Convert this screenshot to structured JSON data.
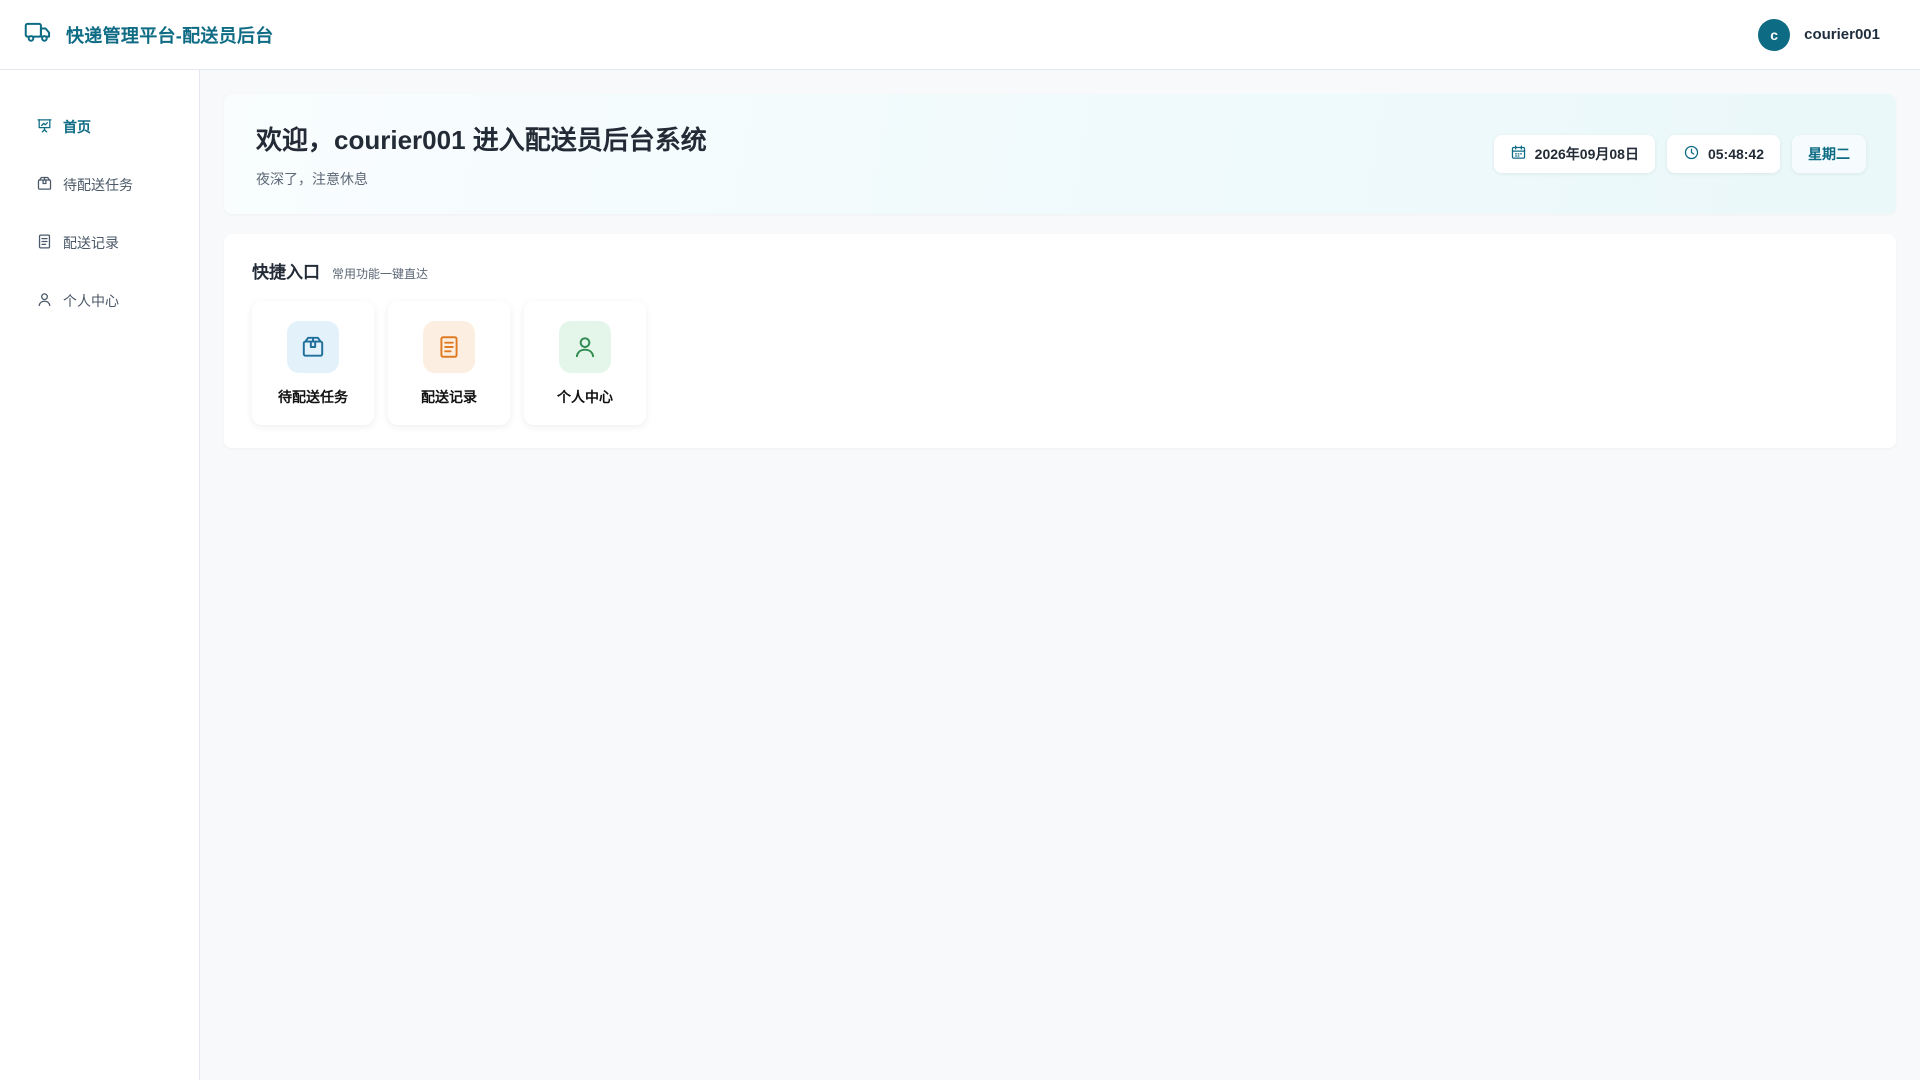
{
  "app": {
    "title": "快递管理平台-配送员后台",
    "logo_icon": "truck-icon",
    "accent_color": "#0e6b84"
  },
  "user": {
    "avatar_letter": "c",
    "name": "courier001"
  },
  "sidebar": {
    "items": [
      {
        "label": "首页",
        "icon": "presentation-chart-icon",
        "active": true
      },
      {
        "label": "待配送任务",
        "icon": "package-icon",
        "active": false
      },
      {
        "label": "配送记录",
        "icon": "document-icon",
        "active": false
      },
      {
        "label": "个人中心",
        "icon": "user-icon",
        "active": false
      }
    ]
  },
  "welcome": {
    "title": "欢迎，courier001 进入配送员后台系统",
    "subtitle": "夜深了，注意休息",
    "date": "2026年09月08日",
    "time": "05:48:42",
    "weekday": "星期二"
  },
  "quick": {
    "title": "快捷入口",
    "subtitle": "常用功能一键直达",
    "tiles": [
      {
        "label": "待配送任务",
        "icon": "package-icon",
        "color": "#1f6f9b",
        "bg": "#e3f1fb"
      },
      {
        "label": "配送记录",
        "icon": "document-icon",
        "color": "#e07b22",
        "bg": "#fcefe1"
      },
      {
        "label": "个人中心",
        "icon": "user-icon",
        "color": "#2f8a4f",
        "bg": "#e4f6ea"
      }
    ]
  }
}
